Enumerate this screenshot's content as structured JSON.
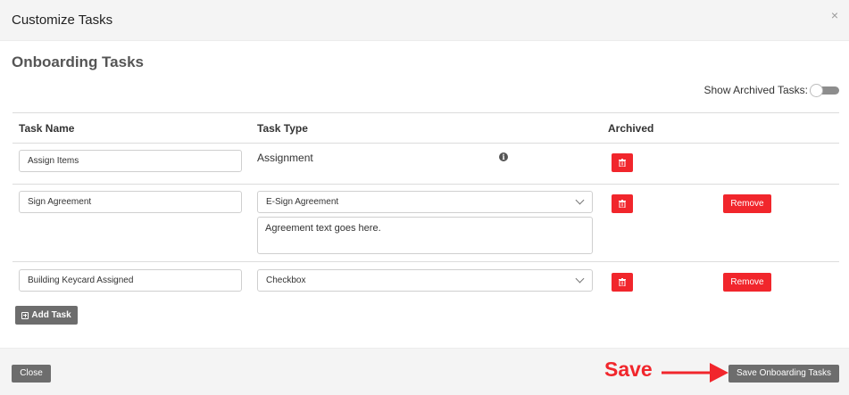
{
  "modal": {
    "title": "Customize Tasks",
    "close_glyph": "×"
  },
  "section": {
    "title": "Onboarding Tasks"
  },
  "archived_toggle": {
    "label": "Show Archived Tasks:",
    "on": false
  },
  "table": {
    "headers": {
      "name": "Task Name",
      "type": "Task Type",
      "archived": "Archived"
    },
    "rows": [
      {
        "name": "Assign Items",
        "type": "Assignment",
        "info_icon": "i",
        "removable": false
      },
      {
        "name": "Sign Agreement",
        "type": "E-Sign Agreement",
        "agreement_text": "Agreement text goes here.",
        "remove_label": "Remove"
      },
      {
        "name": "Building Keycard Assigned",
        "type": "Checkbox",
        "remove_label": "Remove"
      }
    ]
  },
  "add_task": {
    "label": "Add Task",
    "icon": "plus-square-icon"
  },
  "footer": {
    "close_label": "Close",
    "save_label": "Save Onboarding Tasks",
    "annotation": "Save"
  },
  "colors": {
    "danger": "#f1262c",
    "button_gray": "#6d6d6d",
    "header_bg": "#f4f4f4"
  }
}
